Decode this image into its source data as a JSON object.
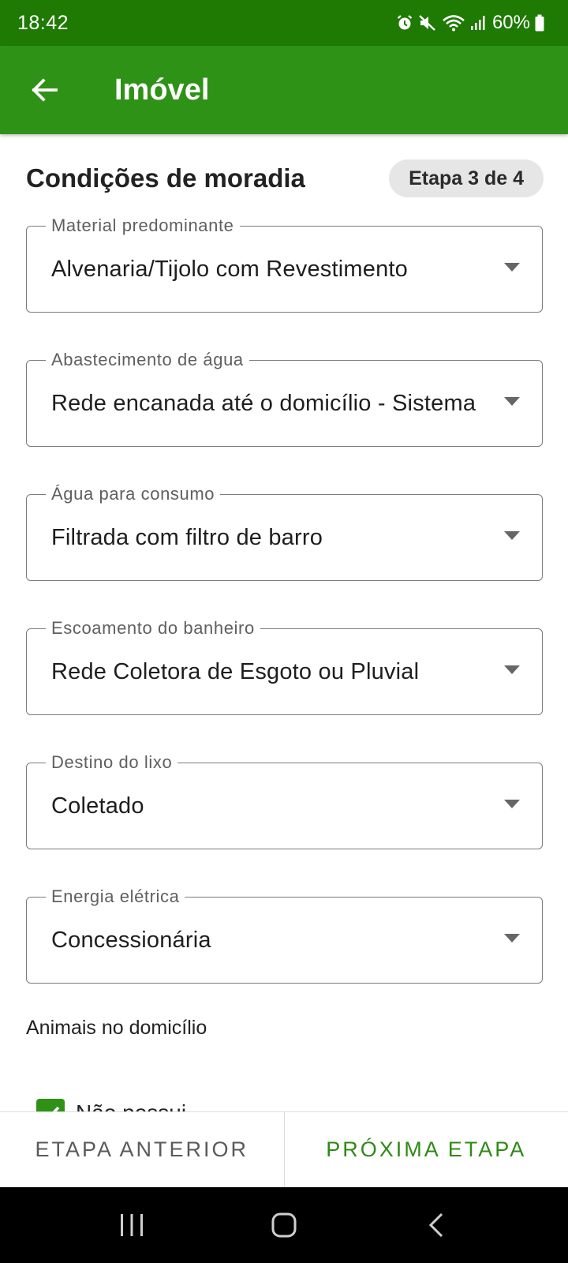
{
  "status_bar": {
    "time": "18:42",
    "battery": "60%",
    "icons": [
      "alarm-icon",
      "mute-icon",
      "wifi-icon",
      "signal-icon",
      "battery-icon"
    ]
  },
  "app_bar": {
    "title": "Imóvel",
    "back_icon": "arrow-back-icon",
    "color": "#2e9216"
  },
  "section": {
    "title": "Condições de moradia",
    "step": "Etapa 3 de 4"
  },
  "fields": [
    {
      "label": "Material predominante",
      "value": "Alvenaria/Tijolo com Revestimento"
    },
    {
      "label": "Abastecimento de água",
      "value": "Rede encanada até o domicílio - Sistema"
    },
    {
      "label": "Água para consumo",
      "value": "Filtrada com filtro de barro"
    },
    {
      "label": "Escoamento do banheiro",
      "value": "Rede Coletora de Esgoto ou Pluvial"
    },
    {
      "label": "Destino do lixo",
      "value": "Coletado"
    },
    {
      "label": "Energia elétrica",
      "value": "Concessionária"
    }
  ],
  "animals": {
    "label": "Animais no domicílio",
    "option_label": "Não possui",
    "checked": true
  },
  "actions": {
    "prev": "ETAPA ANTERIOR",
    "next": "PRÓXIMA ETAPA"
  },
  "colors": {
    "status_bar": "#1f7a04",
    "accent": "#2e9216",
    "next_text": "#2e8a14"
  }
}
